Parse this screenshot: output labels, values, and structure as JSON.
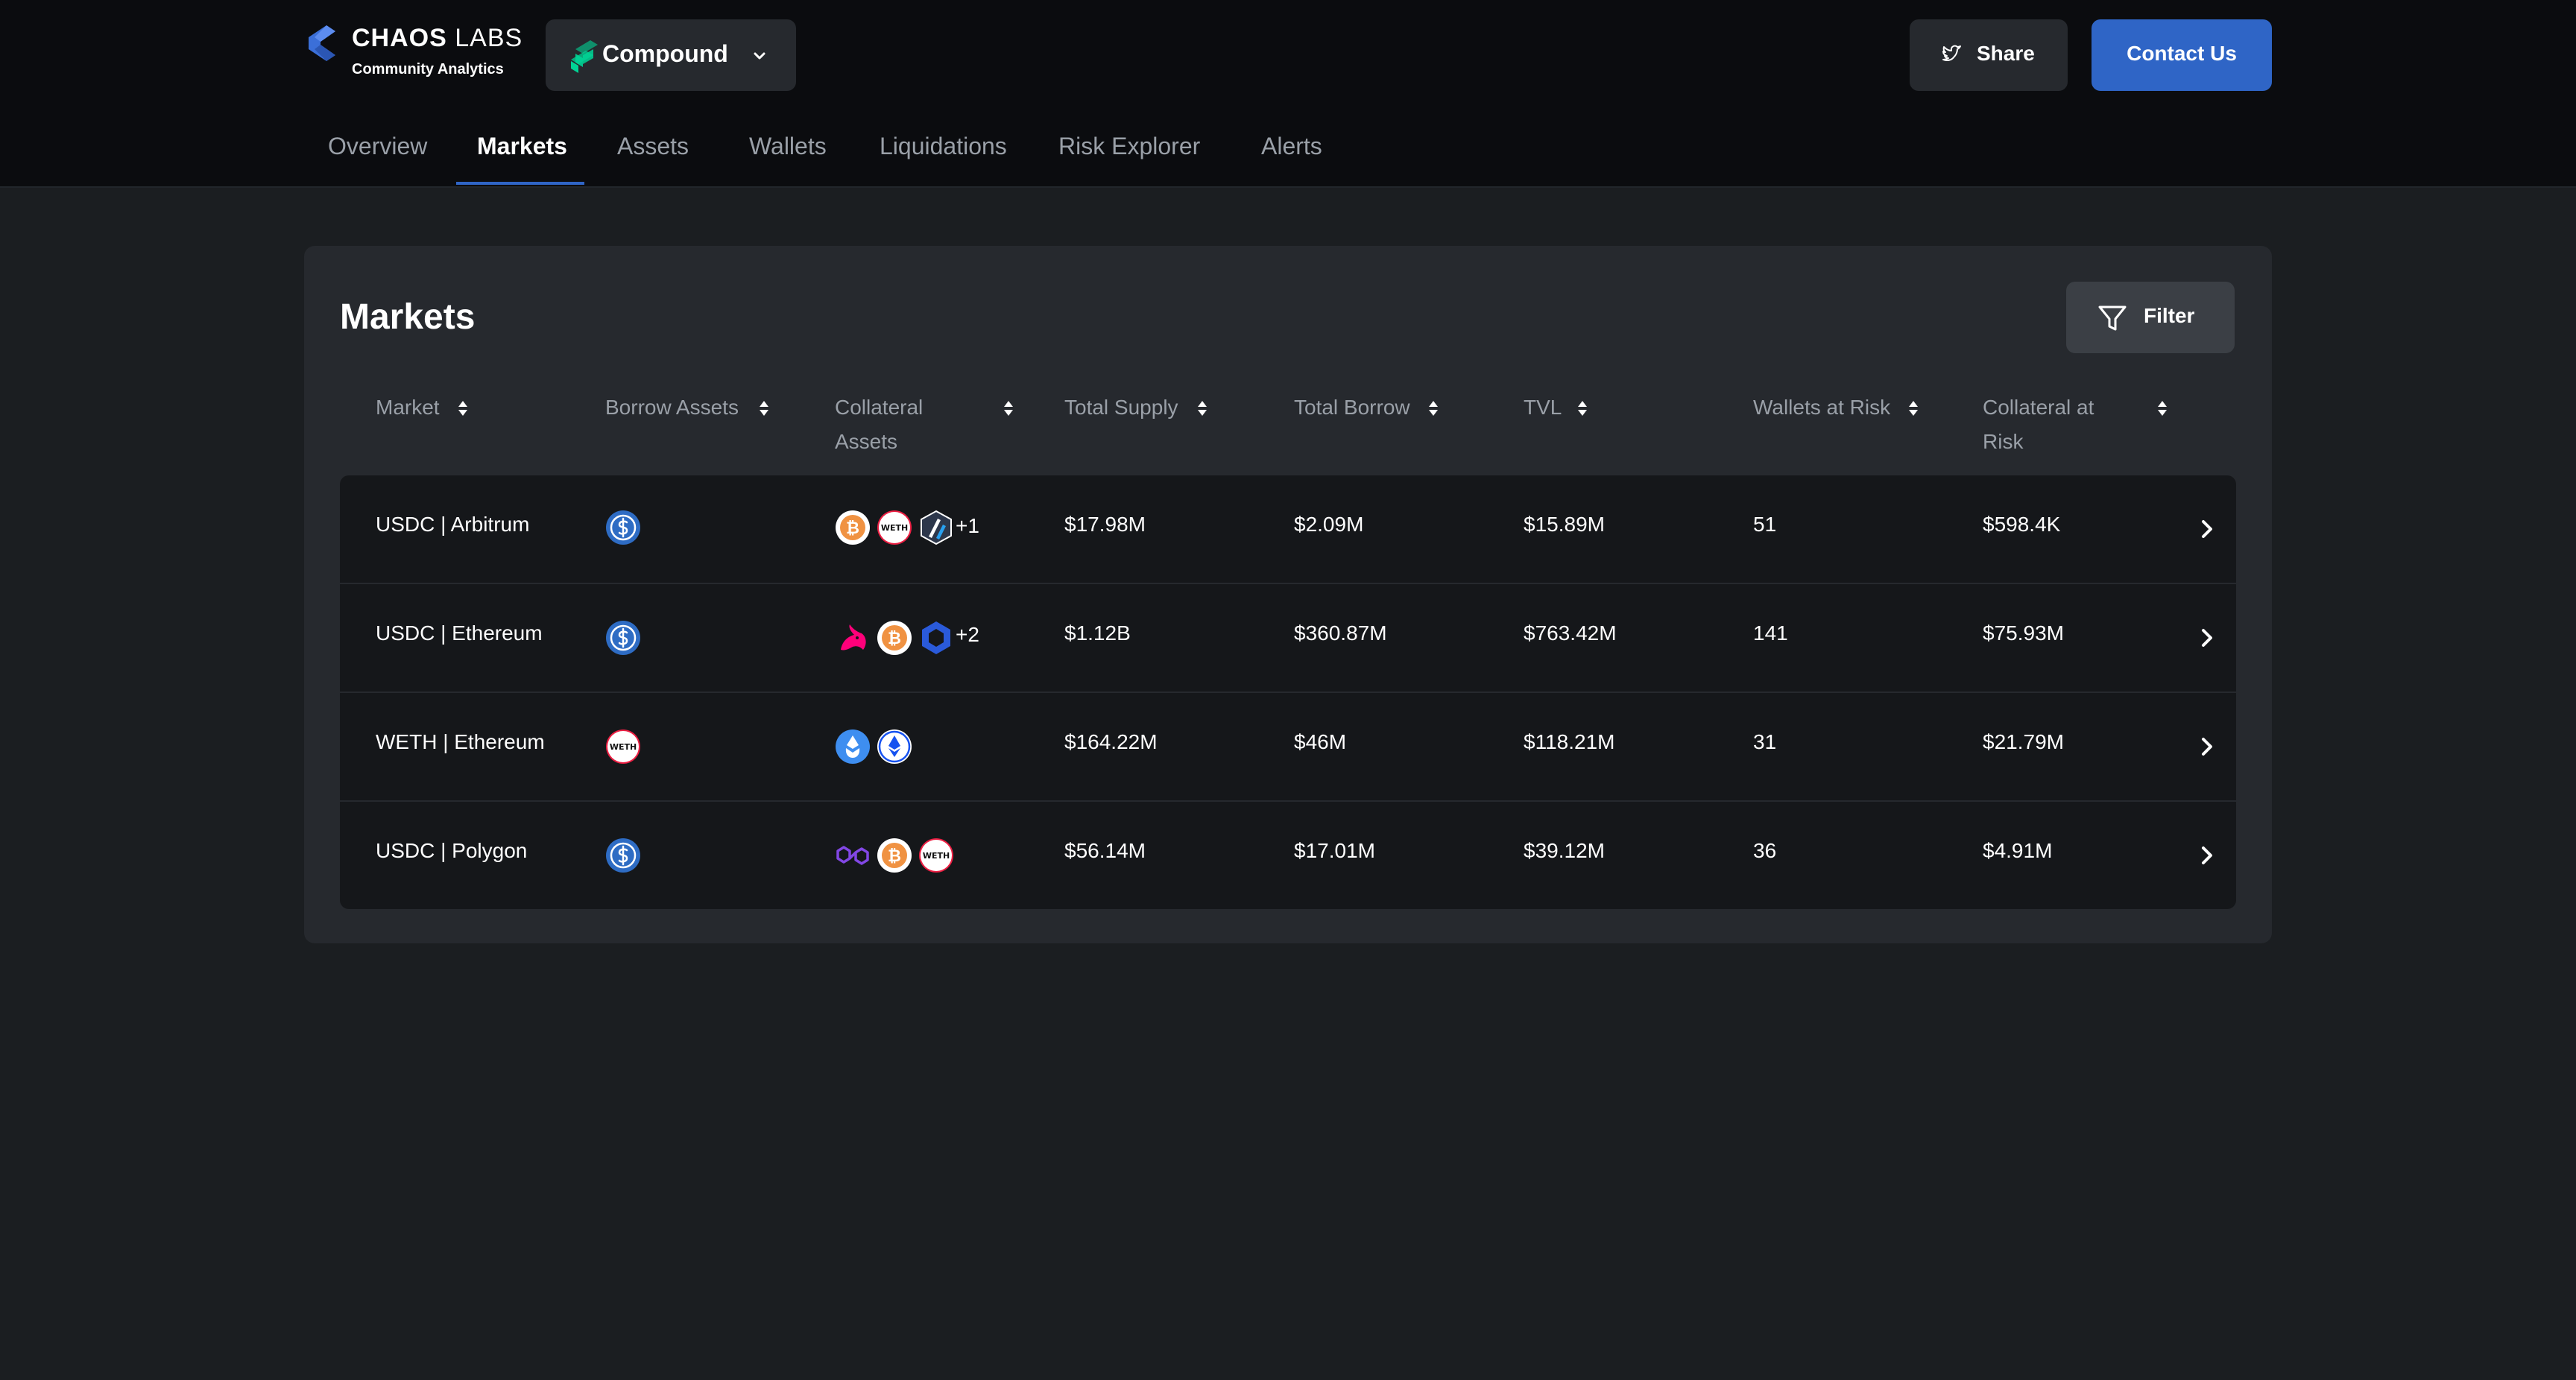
{
  "header": {
    "brand_bold": "CHAOS",
    "brand_light": "LABS",
    "brand_sub": "Community Analytics",
    "protocol": "Compound",
    "share_label": "Share",
    "contact_label": "Contact Us"
  },
  "nav": {
    "tabs": [
      {
        "label": "Overview"
      },
      {
        "label": "Markets"
      },
      {
        "label": "Assets"
      },
      {
        "label": "Wallets"
      },
      {
        "label": "Liquidations"
      },
      {
        "label": "Risk Explorer"
      },
      {
        "label": "Alerts"
      }
    ],
    "active_tab": "Markets"
  },
  "markets": {
    "title": "Markets",
    "filter_label": "Filter",
    "columns": [
      {
        "label": "Market"
      },
      {
        "label": "Borrow Assets"
      },
      {
        "label": "Collateral Assets"
      },
      {
        "label": "Total Supply"
      },
      {
        "label": "Total Borrow"
      },
      {
        "label": "TVL"
      },
      {
        "label": "Wallets at Risk"
      },
      {
        "label": "Collateral at Risk"
      }
    ],
    "rows": [
      {
        "market": "USDC | Arbitrum",
        "borrow_asset": "usdc-icon",
        "collateral_assets": [
          "wbtc-icon",
          "weth-icon",
          "arbitrum-icon"
        ],
        "collateral_more": "+1",
        "total_supply": "$17.98M",
        "total_borrow": "$2.09M",
        "tvl": "$15.89M",
        "wallets_at_risk": "51",
        "collateral_at_risk": "$598.4K"
      },
      {
        "market": "USDC | Ethereum",
        "borrow_asset": "usdc-icon",
        "collateral_assets": [
          "uniswap-icon",
          "wbtc-icon",
          "chainlink-icon"
        ],
        "collateral_more": "+2",
        "total_supply": "$1.12B",
        "total_borrow": "$360.87M",
        "tvl": "$763.42M",
        "wallets_at_risk": "141",
        "collateral_at_risk": "$75.93M"
      },
      {
        "market": "WETH | Ethereum",
        "borrow_asset": "weth-icon",
        "collateral_assets": [
          "steth-icon",
          "cbeth-icon"
        ],
        "collateral_more": "",
        "total_supply": "$164.22M",
        "total_borrow": "$46M",
        "tvl": "$118.21M",
        "wallets_at_risk": "31",
        "collateral_at_risk": "$21.79M"
      },
      {
        "market": "USDC | Polygon",
        "borrow_asset": "usdc-icon",
        "collateral_assets": [
          "polygon-icon",
          "wbtc-icon",
          "weth-icon"
        ],
        "collateral_more": "",
        "total_supply": "$56.14M",
        "total_borrow": "$17.01M",
        "tvl": "$39.12M",
        "wallets_at_risk": "36",
        "collateral_at_risk": "$4.91M"
      }
    ]
  },
  "icons": {
    "weth_text": "WETH",
    "wbtc_glyph": "₿"
  },
  "colors": {
    "accent": "#2f65c6",
    "header_bg": "#0b0c0f",
    "page_bg": "#1b1e21",
    "card_bg": "#26292e",
    "row_bg": "#15171a",
    "muted_text": "#9aa0a8",
    "compound_green": "#00d395"
  }
}
